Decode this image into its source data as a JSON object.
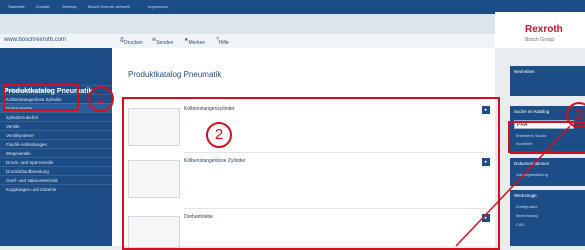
{
  "topnav": {
    "items": [
      "Startseite",
      "Kontakt",
      "Sitemap",
      "Bosch Rexroth weltweit",
      "Impressum"
    ]
  },
  "logo": {
    "brand": "Rexroth",
    "sub": "Bosch Group"
  },
  "urlbar": {
    "url": "www.boschrexroth.com"
  },
  "toolbar": {
    "print": "Drucken",
    "send": "Senden",
    "bookmark": "Merken",
    "help": "Hilfe"
  },
  "sidebar": {
    "title": "Produktkatalog Pneumatik",
    "items": [
      "Kolbenstangenzylinder",
      "Kolbenstangenlose Zylinder",
      "Drehantriebe",
      "Zylinderzubehör",
      "Ventile",
      "Ventilsysteme",
      "Fluidik-Anbindungen",
      "Wegeventile",
      "Druck- und Sperrventile",
      "Druckluftaufbereitung",
      "Greif- und Vakuumtechnik",
      "Kupplungen und Zubehör"
    ]
  },
  "main": {
    "heading": "Produktkatalog Pneumatik",
    "products": [
      {
        "name": "Kolbenstangenzylinder"
      },
      {
        "name": "Kolbenstangenlose Zylinder"
      },
      {
        "name": "Drehantriebe"
      }
    ]
  },
  "right": {
    "box1": {
      "title": "Neuheiten"
    },
    "box2": {
      "title": "Suche im Katalog",
      "value": "PRA",
      "link1": "Erweiterte Suche",
      "link2": "Suchhilfe"
    },
    "box3": {
      "title": "Dokumentationen",
      "link1": "Katalogbestellung"
    },
    "box4": {
      "title": "Werkzeuge",
      "link1": "Konfigurator",
      "link2": "Berechnung",
      "link3": "CAD"
    }
  },
  "annotations": [
    "1",
    "2",
    "3"
  ],
  "colors": {
    "primary": "#1d4d86",
    "highlight": "#d4101e",
    "brand": "#c8102e"
  }
}
